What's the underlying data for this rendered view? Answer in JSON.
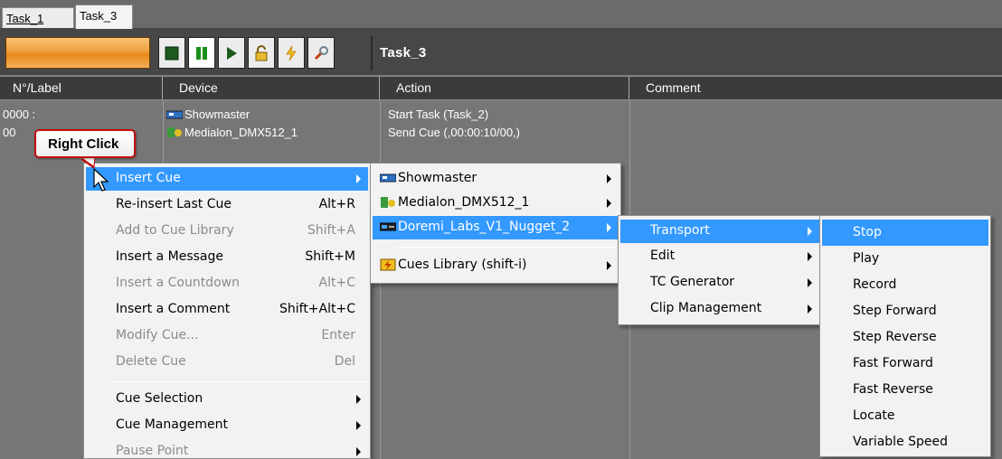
{
  "tabs": [
    {
      "label": "Task_1"
    },
    {
      "label": "Task_3",
      "active": true
    }
  ],
  "toolbar": {
    "task_title": "Task_3",
    "buttons": [
      "stop-icon",
      "pause-icon",
      "play-icon",
      "lock-icon",
      "lightning-icon",
      "wrench-icon"
    ]
  },
  "columns": {
    "label": "N°/Label",
    "device": "Device",
    "action": "Action",
    "comment": "Comment"
  },
  "rows": [
    {
      "num": "0000 :",
      "device": "Showmaster",
      "action": "Start Task (Task_2)"
    },
    {
      "num": "00",
      "device": "Medialon_DMX512_1",
      "action": "Send Cue (,00:00:10/00,)"
    }
  ],
  "callout": {
    "text": "Right Click"
  },
  "context_menu": {
    "items": [
      {
        "label": "Insert Cue",
        "shortcut": "",
        "submenu": true,
        "selected": true
      },
      {
        "label": "Re-insert Last Cue",
        "shortcut": "Alt+R"
      },
      {
        "label": "Add to Cue Library",
        "shortcut": "Shift+A",
        "disabled": true
      },
      {
        "label": "Insert a Message",
        "shortcut": "Shift+M"
      },
      {
        "label": "Insert a Countdown",
        "shortcut": "Alt+C",
        "disabled": true
      },
      {
        "label": "Insert a Comment",
        "shortcut": "Shift+Alt+C"
      },
      {
        "label": "Modify Cue...",
        "shortcut": "Enter",
        "disabled": true
      },
      {
        "label": "Delete Cue",
        "shortcut": "Del",
        "disabled": true
      },
      {
        "label": "Cue Selection",
        "submenu": true
      },
      {
        "label": "Cue Management",
        "submenu": true
      },
      {
        "label": "Pause Point",
        "submenu": true,
        "disabled": true
      }
    ]
  },
  "device_menu": {
    "items": [
      {
        "label": "Showmaster"
      },
      {
        "label": "Medialon_DMX512_1"
      },
      {
        "label": "Doremi_Labs_V1_Nugget_2",
        "selected": true
      },
      {
        "label": "Cues Library (shift-i)"
      }
    ]
  },
  "category_menu": {
    "items": [
      {
        "label": "Transport",
        "selected": true
      },
      {
        "label": "Edit"
      },
      {
        "label": "TC Generator"
      },
      {
        "label": "Clip Management"
      }
    ]
  },
  "command_menu": {
    "items": [
      {
        "label": "Stop",
        "selected": true
      },
      {
        "label": "Play"
      },
      {
        "label": "Record"
      },
      {
        "label": "Step Forward"
      },
      {
        "label": "Step Reverse"
      },
      {
        "label": "Fast Forward"
      },
      {
        "label": "Fast Reverse"
      },
      {
        "label": "Locate"
      },
      {
        "label": "Variable Speed"
      }
    ]
  },
  "colors": {
    "selection": "#3399ff",
    "callout_border": "#c21010",
    "progress": "#f0a040"
  }
}
